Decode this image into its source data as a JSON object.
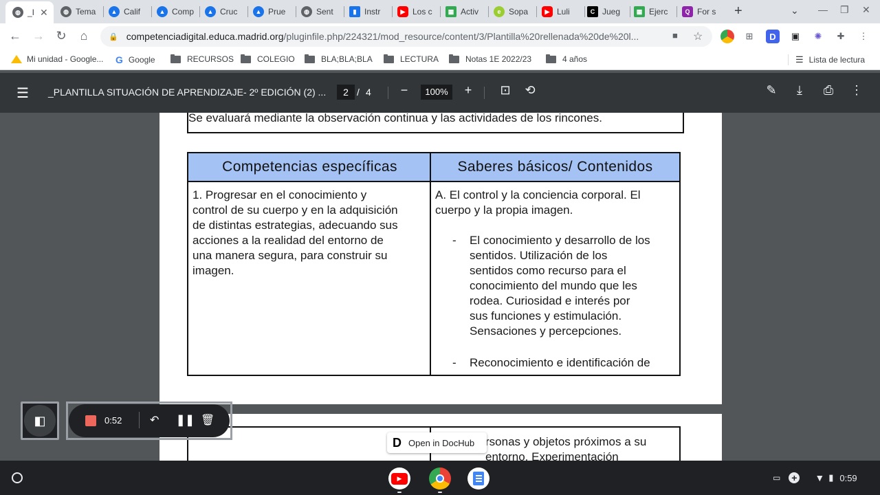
{
  "tabs": [
    {
      "label": "_I",
      "icon": "globe-icon",
      "active": true
    },
    {
      "label": "Tema",
      "icon": "globe-icon"
    },
    {
      "label": "Calif",
      "icon": "graduation-cap-icon"
    },
    {
      "label": "Comp",
      "icon": "graduation-cap-icon"
    },
    {
      "label": "Cruc",
      "icon": "graduation-cap-icon"
    },
    {
      "label": "Prue",
      "icon": "graduation-cap-icon"
    },
    {
      "label": "Sent",
      "icon": "globe-icon"
    },
    {
      "label": "Instr",
      "icon": "bar-chart-icon"
    },
    {
      "label": "Los c",
      "icon": "youtube-icon"
    },
    {
      "label": "Activ",
      "icon": "grid-app-icon"
    },
    {
      "label": "Sopa",
      "icon": "green-circle-icon"
    },
    {
      "label": "Luli",
      "icon": "youtube-icon"
    },
    {
      "label": "Jueg",
      "icon": "c-logo-icon"
    },
    {
      "label": "Ejerc",
      "icon": "grid-app-icon"
    },
    {
      "label": "For s",
      "icon": "quiz-icon"
    }
  ],
  "address": {
    "host": "competenciadigital.educa.madrid.org",
    "path": "/pluginfile.php/224321/mod_resource/content/3/Plantilla%20rellenada%20de%20l..."
  },
  "bookmarks": {
    "items": [
      {
        "label": "Mi unidad - Google...",
        "icon": "drive-icon"
      },
      {
        "label": "Google",
        "icon": "google-icon"
      },
      {
        "label": "RECURSOS",
        "icon": "folder-icon"
      },
      {
        "label": "COLEGIO",
        "icon": "folder-icon"
      },
      {
        "label": "BLA;BLA;BLA",
        "icon": "folder-icon"
      },
      {
        "label": "LECTURA",
        "icon": "folder-icon"
      },
      {
        "label": "Notas 1E 2022/23",
        "icon": "folder-icon"
      },
      {
        "label": "4 años",
        "icon": "folder-icon"
      }
    ],
    "reading_list": "Lista de lectura"
  },
  "pdf": {
    "title": "_PLANTILLA SITUACIÓN DE APRENDIZAJE- 2º EDICIÓN (2) ...",
    "page": "2",
    "separator": "/",
    "total": "4",
    "zoom": "100%"
  },
  "document": {
    "top_text": "Se evaluará mediante la observación continua y las actividades de los rincones.",
    "table": {
      "col1_header": "Competencias específicas",
      "col2_header": "Saberes básicos/ Contenidos",
      "col1_lines": [
        "1. Progresar en el conocimiento y",
        "control de su cuerpo y en la adquisición",
        "de distintas estrategias, adecuando sus",
        "acciones a la realidad del entorno de",
        "una manera segura, para construir su",
        "imagen."
      ],
      "col2_intro_lines": [
        "A. El control y la conciencia corporal. El",
        "cuerpo y la propia imagen."
      ],
      "bullet1_lines": [
        "El conocimiento y desarrollo de los",
        "sentidos. Utilización de los",
        "sentidos como recurso para el",
        "conocimiento del mundo que les",
        "rodea. Curiosidad e interés por",
        "sus funciones y estimulación.",
        "Sensaciones y percepciones."
      ],
      "bullet2_line": "Reconocimiento e identificación de",
      "bullet_marker": "-"
    },
    "next_page_lines": [
      "rsonas y objetos próximos a su",
      "entorno. Experimentación"
    ]
  },
  "recorder": {
    "time": "0:52"
  },
  "dochub": {
    "label": "Open in DocHub",
    "logo": "D"
  },
  "shelf": {
    "clock": "0:59"
  },
  "colors": {
    "table_header": "#a4c2f4",
    "pdf_toolbar": "#323639",
    "viewer_bg": "#525659",
    "record_red": "#ee675c"
  }
}
